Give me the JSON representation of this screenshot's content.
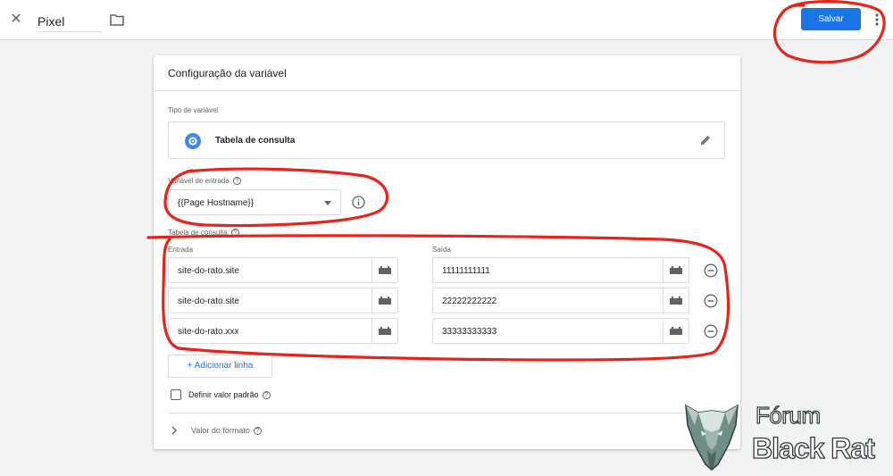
{
  "topbar": {
    "close_icon": "close-icon",
    "name_value": "Pixel",
    "folder_icon": "folder-icon",
    "save_label": "Salvar",
    "more_icon": "more-vert-icon"
  },
  "card": {
    "title": "Configuração da variável",
    "variable_type": {
      "label": "Tipo de variável",
      "value": "Tabela de consulta",
      "icon": "settings-gear-icon",
      "edit_icon": "pencil-icon"
    },
    "input_variable": {
      "label": "Variável de entrada",
      "value": "{{Page Hostname}}"
    },
    "lookup_table": {
      "label": "Tabela de consulta",
      "col_input": "Entrada",
      "col_output": "Saída",
      "rows": [
        {
          "input": "site-do-rato.site",
          "output": "11111111111"
        },
        {
          "input": "site-do-rato.site",
          "output": "22222222222"
        },
        {
          "input": "site-do-rato.xxx",
          "output": "33333333333"
        }
      ]
    },
    "add_row_label": "+ Adicionar linha",
    "default_value_label": "Definir valor padrão",
    "format_value_label": "Valor do formato"
  },
  "colors": {
    "accent": "#1a73e8",
    "annotation": "#e8231b",
    "background": "#f1f3f4"
  },
  "watermark": {
    "line1": "Fórum",
    "line2": "Black Rat"
  }
}
